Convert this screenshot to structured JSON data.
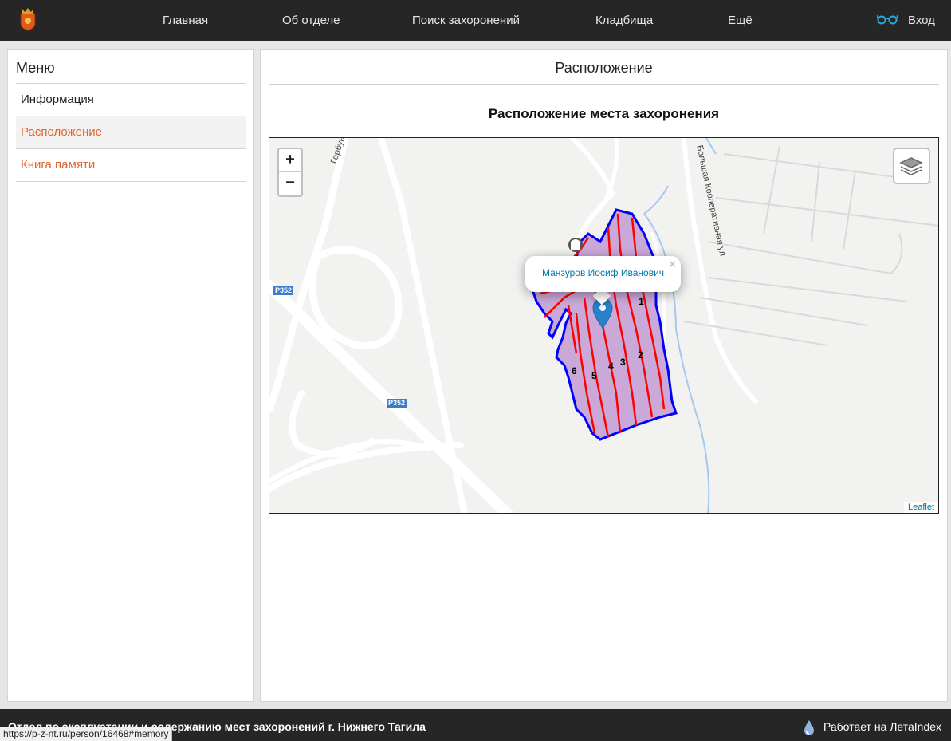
{
  "nav": {
    "items": [
      "Главная",
      "Об отделе",
      "Поиск захоронений",
      "Кладбища",
      "Ещё"
    ],
    "login_label": "Вход"
  },
  "sidebar": {
    "title": "Меню",
    "items": [
      {
        "label": "Информация"
      },
      {
        "label": "Расположение"
      },
      {
        "label": "Книга памяти"
      }
    ]
  },
  "main": {
    "title": "Расположение",
    "map_title": "Расположение места захоронения"
  },
  "map": {
    "zoom_in": "+",
    "zoom_out": "−",
    "popup_text": "Манзуров Иосиф Иванович",
    "popup_close": "×",
    "attribution": "Leaflet",
    "street_1": "Горбуновская",
    "street_2": "Большая Кооперативная ул.",
    "route_shield": "Р352",
    "sections": [
      "1",
      "2",
      "3",
      "4",
      "5",
      "6"
    ],
    "colors": {
      "cemetery_fill": "#c39bd3",
      "cemetery_border": "#0000ff",
      "section_lines": "#ff0000",
      "marker": "#2a81cb"
    }
  },
  "footer": {
    "text": "Отдел по эксплуатации и содержанию мест захоронений г. Нижнего Тагила",
    "powered": "Работает на ЛетаIndex"
  },
  "status_url": "https://p-z-nt.ru/person/16468#memory"
}
